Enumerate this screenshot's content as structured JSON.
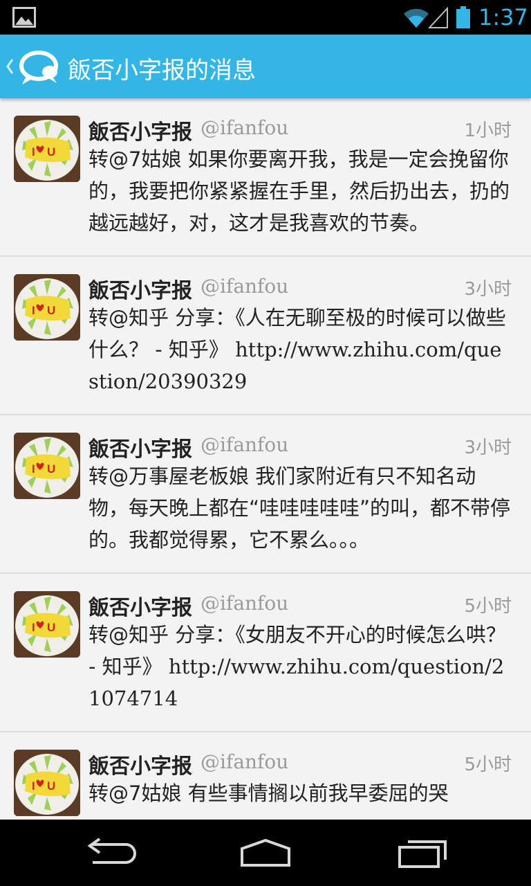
{
  "status_bar": {
    "time": "1:37",
    "icons": [
      "image-notification-icon",
      "wifi-icon",
      "signal-icon",
      "battery-icon"
    ],
    "accent_color": "#33b5e5"
  },
  "action_bar": {
    "title": "飯否小字报的消息",
    "icon": "chat-bubbles-icon",
    "background_color": "#33b5e5"
  },
  "messages": [
    {
      "name": "飯否小字报",
      "handle": "@ifanfou",
      "time": "1小时",
      "text": "转@7姑娘 如果你要离开我，我是一定会挽留你的，我要把你紧紧握在手里，然后扔出去，扔的越远越好，对，这才是我喜欢的节奏。"
    },
    {
      "name": "飯否小字报",
      "handle": "@ifanfou",
      "time": "3小时",
      "text": "转@知乎 分享：《人在无聊至极的时候可以做些什么？ - 知乎》 ",
      "url": "http://www.zhihu.com/question/20390329"
    },
    {
      "name": "飯否小字报",
      "handle": "@ifanfou",
      "time": "3小时",
      "text": "转@万事屋老板娘 我们家附近有只不知名动物，每天晚上都在“哇哇哇哇哇”的叫，都不带停的。我都觉得累，它不累么。。。"
    },
    {
      "name": "飯否小字报",
      "handle": "@ifanfou",
      "time": "5小时",
      "text": "转@知乎 分享：《女朋友不开心的时候怎么哄？ - 知乎》 ",
      "url": "http://www.zhihu.com/question/21074714"
    },
    {
      "name": "飯否小字报",
      "handle": "@ifanfou",
      "time": "5小时",
      "text": "转@7姑娘 有些事情搁以前我早委屈的哭"
    }
  ],
  "nav_bar": {
    "buttons": [
      "back-icon",
      "home-icon",
      "recent-apps-icon"
    ]
  }
}
